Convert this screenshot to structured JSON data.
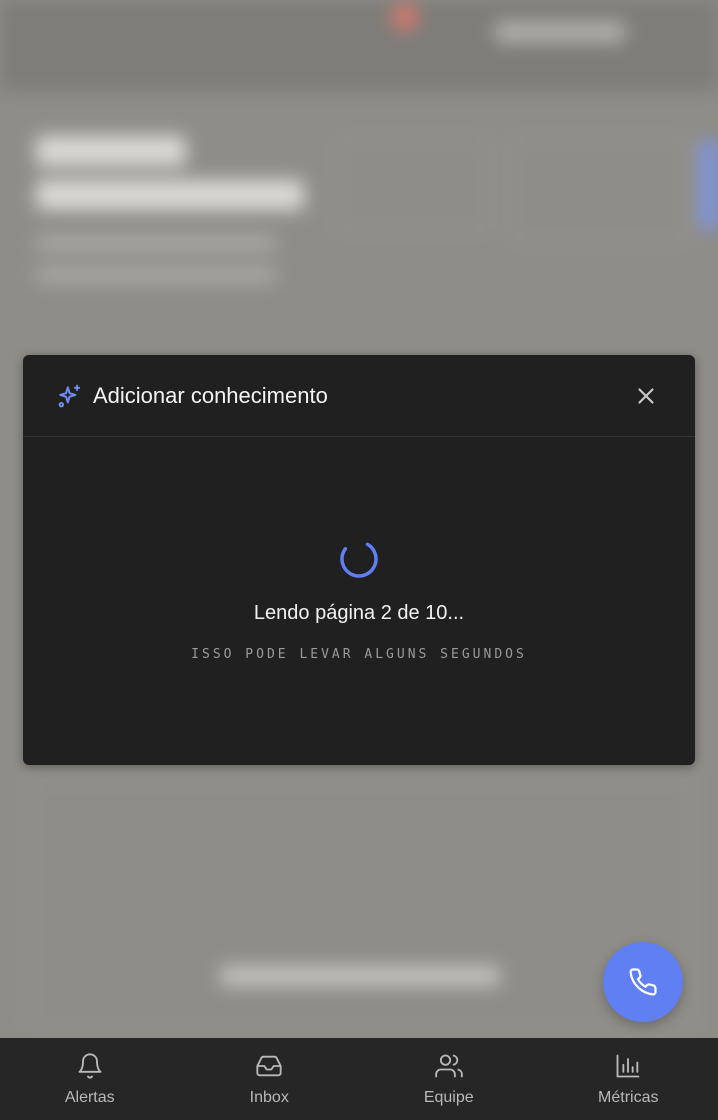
{
  "modal": {
    "title": "Adicionar conhecimento",
    "loading_text": "Lendo página 2 de 10...",
    "loading_subtext": "ISSO PODE LEVAR ALGUNS SEGUNDOS",
    "icon": "sparkle-icon",
    "close_icon": "close-icon"
  },
  "fab": {
    "icon": "phone-icon"
  },
  "bottom_nav": {
    "items": [
      {
        "label": "Alertas",
        "icon": "bell-icon"
      },
      {
        "label": "Inbox",
        "icon": "inbox-icon"
      },
      {
        "label": "Equipe",
        "icon": "users-icon"
      },
      {
        "label": "Métricas",
        "icon": "bar-chart-icon"
      }
    ]
  },
  "colors": {
    "accent": "#5f7ff2",
    "modal_bg": "#202021",
    "nav_bg": "#262627",
    "backdrop": "#8d8b86"
  }
}
